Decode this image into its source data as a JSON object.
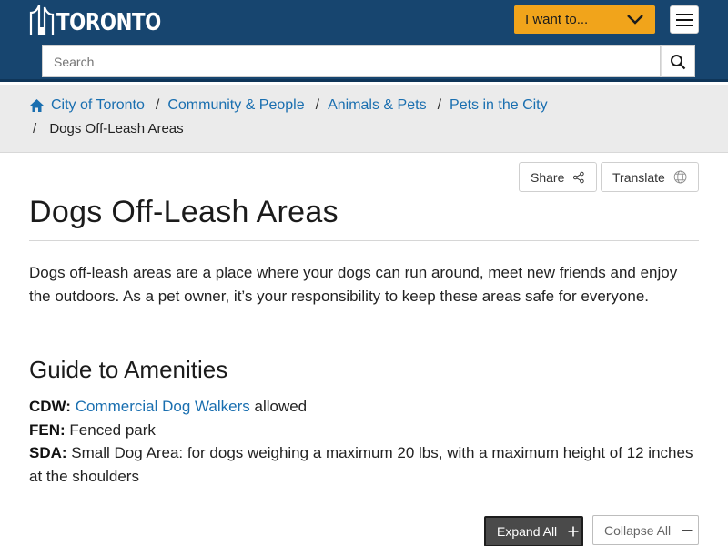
{
  "header": {
    "logo_text": "TORONTO",
    "i_want_label": "I want to...",
    "search_placeholder": "Search"
  },
  "breadcrumb": {
    "items": [
      "City of Toronto",
      "Community & People",
      "Animals & Pets",
      "Pets in the City"
    ],
    "current": "Dogs Off-Leash Areas",
    "separator": "/"
  },
  "tools": {
    "share_label": "Share",
    "translate_label": "Translate"
  },
  "page": {
    "title": "Dogs Off-Leash Areas",
    "intro": "Dogs off-leash areas are a place where your dogs can run around, meet new friends and enjoy the outdoors. As a pet owner, it’s your responsibility to keep these areas safe for everyone.",
    "section_title": "Guide to Amenities",
    "amenities": [
      {
        "code": "CDW:",
        "link": "Commercial Dog Walkers",
        "text": " allowed"
      },
      {
        "code": "FEN:",
        "text": " Fenced park"
      },
      {
        "code": "SDA:",
        "text": " Small Dog Area: for dogs weighing a maximum 20 lbs, with a maximum height of 12 inches at the shoulders"
      }
    ]
  },
  "accordion": {
    "expand_label": "Expand All",
    "collapse_label": "Collapse All"
  },
  "colors": {
    "header_bg": "#17456f",
    "accent": "#f1a41b",
    "link": "#1a6fb0"
  }
}
